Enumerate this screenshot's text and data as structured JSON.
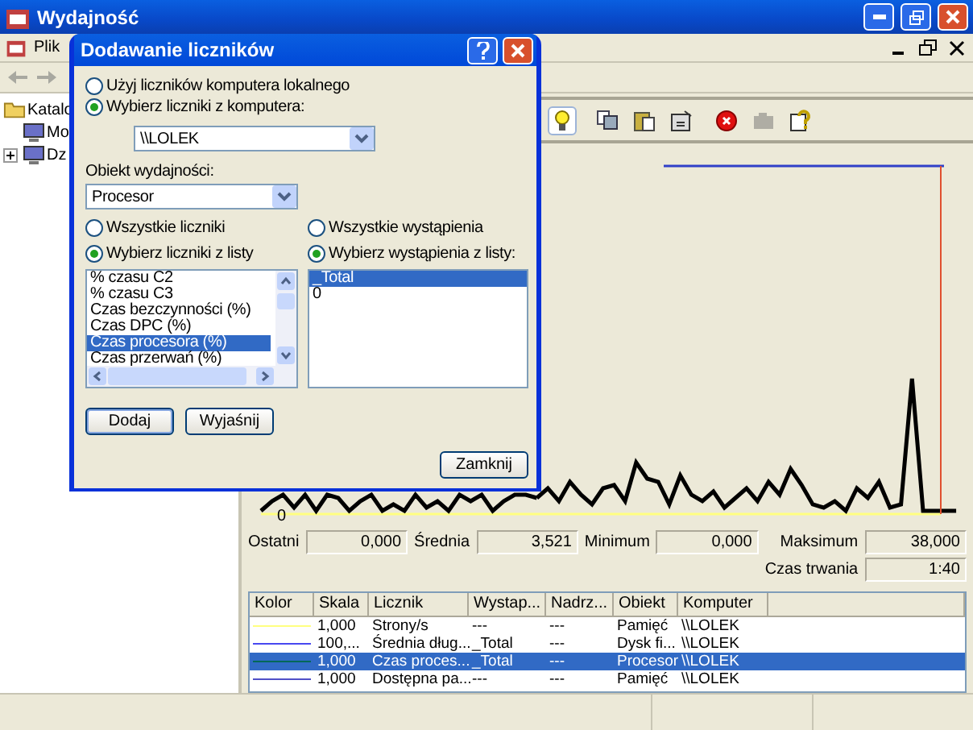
{
  "window": {
    "title": "Wydajność"
  },
  "menu": [
    "Plik"
  ],
  "tree": [
    {
      "label": "Katalo",
      "children": [
        {
          "label": "Mo"
        },
        {
          "label": "Dz",
          "expanded": false
        }
      ]
    }
  ],
  "toolbar": [
    {
      "kind": "bulb",
      "pressed": true,
      "disabled": false
    },
    {
      "kind": "copy",
      "pressed": false,
      "disabled": false
    },
    {
      "kind": "paste",
      "pressed": false,
      "disabled": false
    },
    {
      "kind": "properties",
      "pressed": false,
      "disabled": false
    },
    {
      "kind": "delete",
      "pressed": false,
      "disabled": false
    },
    {
      "kind": "camera",
      "pressed": false,
      "disabled": true
    },
    {
      "kind": "help",
      "pressed": false,
      "disabled": false
    }
  ],
  "graph": {
    "axis_min": "0"
  },
  "stats": [
    {
      "label": "Ostatni",
      "value": "0,000"
    },
    {
      "label": "Średnia",
      "value": "3,521"
    },
    {
      "label": "Minimum",
      "value": "0,000"
    },
    {
      "label": "Maksimum",
      "value": "38,000"
    }
  ],
  "duration": {
    "label": "Czas trwania",
    "value": "1:40"
  },
  "table": {
    "color_column": "Kolor",
    "columns": [
      "Skala",
      "Licznik",
      "Wystap...",
      "Nadrz...",
      "Obiekt",
      "Komputer"
    ],
    "rows": [
      {
        "color": "#ffff80",
        "selected": false,
        "cells": [
          "1,000",
          "Strony/s",
          "---",
          "---",
          "Pamięć",
          "\\\\LOLEK"
        ]
      },
      {
        "color": "#4848f0",
        "selected": false,
        "cells": [
          "100,...",
          "Średnia dług...",
          "_Total",
          "---",
          "Dysk fi...",
          "\\\\LOLEK"
        ]
      },
      {
        "color": "#006858",
        "selected": true,
        "cells": [
          "1,000",
          "Czas proces...",
          "_Total",
          "---",
          "Procesor",
          "\\\\LOLEK"
        ]
      },
      {
        "color": "#5050c8",
        "selected": false,
        "cells": [
          "1,000",
          "Dostępna pa...",
          "---",
          "---",
          "Pamięć",
          "\\\\LOLEK"
        ]
      }
    ]
  },
  "dialog": {
    "title": "Dodawanie liczników",
    "source_options": [
      {
        "label": "Użyj liczników komputera lokalnego",
        "selected": false
      },
      {
        "label": "Wybierz liczniki z komputera:",
        "selected": true
      }
    ],
    "computer": "\\\\LOLEK",
    "object_label": "Obiekt wydajności:",
    "object": "Procesor",
    "counter_options": [
      {
        "label": "Wszystkie liczniki",
        "selected": false
      },
      {
        "label": "Wybierz liczniki z listy",
        "selected": true
      }
    ],
    "instance_options": [
      {
        "label": "Wszystkie wystąpienia",
        "selected": false
      },
      {
        "label": "Wybierz wystąpienia z listy:",
        "selected": true
      }
    ],
    "counters": [
      {
        "label": "% czasu C2",
        "selected": false
      },
      {
        "label": "% czasu C3",
        "selected": false
      },
      {
        "label": "Czas bezczynności (%)",
        "selected": false
      },
      {
        "label": "Czas DPC (%)",
        "selected": false
      },
      {
        "label": "Czas procesora (%)",
        "selected": true
      },
      {
        "label": "Czas przerwań (%)",
        "selected": false
      }
    ],
    "instances": [
      {
        "label": "_Total",
        "selected": true
      },
      {
        "label": "0",
        "selected": false
      }
    ],
    "buttons": [
      {
        "label": "Dodaj",
        "default": true
      },
      {
        "label": "Wyjaśnij",
        "default": false
      }
    ],
    "close_button": "Zamknij"
  }
}
